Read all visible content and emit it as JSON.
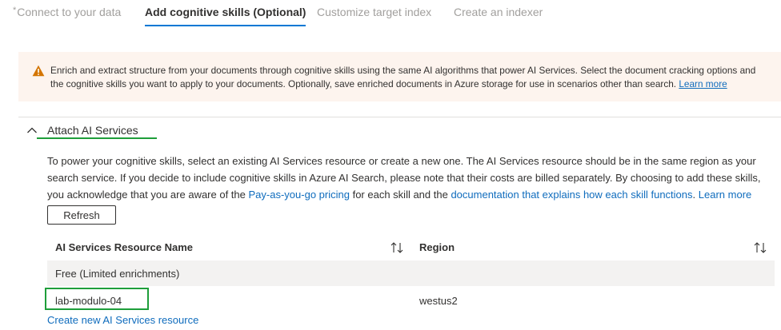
{
  "tabs": [
    {
      "label": "Connect to your data",
      "required_marker": "*"
    },
    {
      "label": "Add cognitive skills (Optional)"
    },
    {
      "label": "Customize target index"
    },
    {
      "label": "Create an indexer"
    }
  ],
  "warning": {
    "text": "Enrich and extract structure from your documents through cognitive skills using the same AI algorithms that power AI Services. Select the document cracking options and the cognitive skills you want to apply to your documents. Optionally, save enriched documents in Azure storage for use in scenarios other than search.",
    "link": "Learn more",
    "icon": "warning-triangle-icon",
    "icon_color": "#d47500"
  },
  "section": {
    "title": "Attach AI Services",
    "icon": "chevron-up-icon"
  },
  "description": {
    "part1": "To power your cognitive skills, select an existing AI Services resource or create a new one. The AI Services resource should be in the same region as your search service. If you decide to include cognitive skills in Azure AI Search, please note that their costs are billed separately. By choosing to add these skills, you acknowledge that you are aware of the",
    "link1": "Pay-as-you-go pricing",
    "part2": "for each skill and the",
    "link2": "documentation that explains how each skill functions",
    "part3": ".",
    "link3": "Learn more"
  },
  "refresh_label": "Refresh",
  "table": {
    "columns": [
      "AI Services Resource Name",
      "Region"
    ],
    "free_row": "Free (Limited enrichments)",
    "rows": [
      {
        "name": "lab-modulo-04",
        "region": "westus2"
      }
    ]
  },
  "create_link": "Create new AI Services resource",
  "colors": {
    "accent": "#0078d4",
    "link": "#0f6cbd",
    "highlight": "#1e9e3a",
    "warning_bg": "#fdf4ee"
  }
}
